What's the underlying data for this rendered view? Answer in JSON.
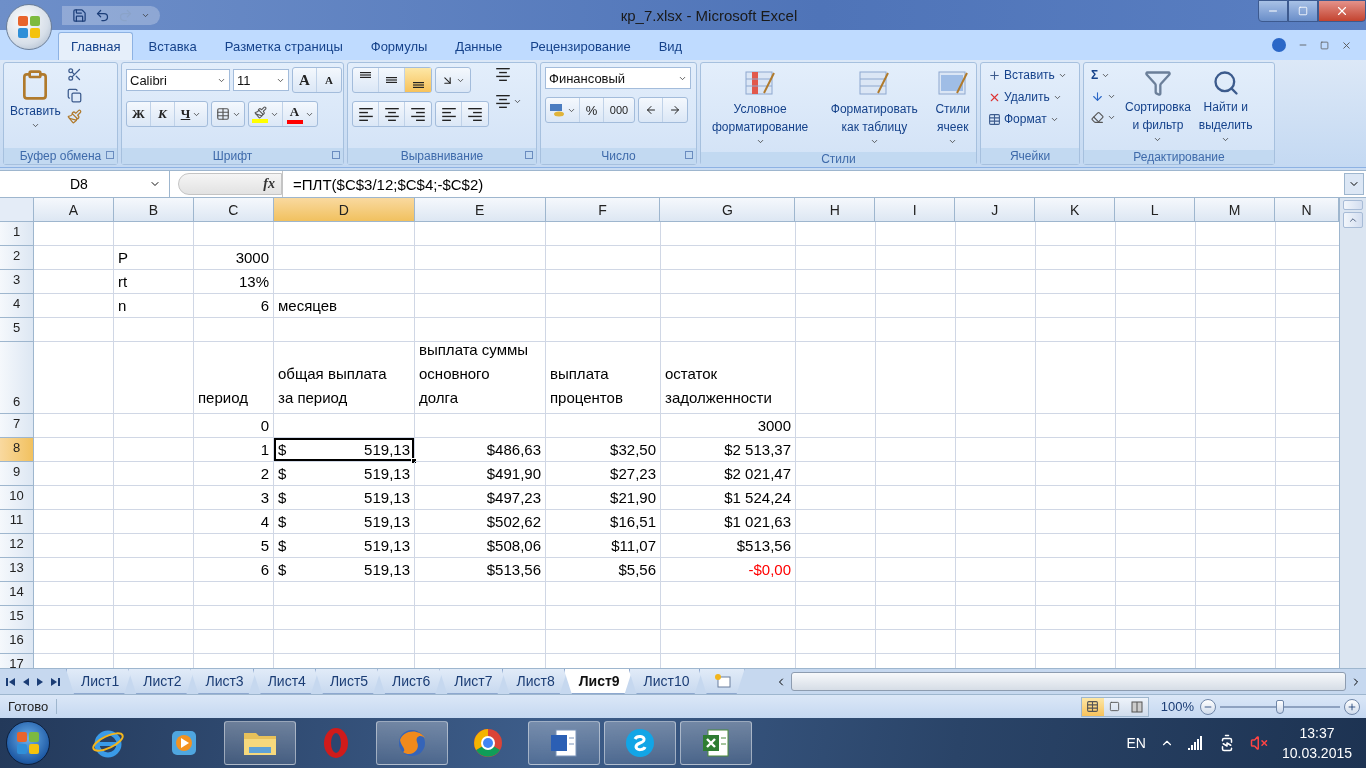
{
  "window": {
    "title": "кр_7.xlsx - Microsoft Excel"
  },
  "ribbon_tabs": [
    {
      "label": "Главная",
      "selected": true
    },
    {
      "label": "Вставка",
      "selected": false
    },
    {
      "label": "Разметка страницы",
      "selected": false
    },
    {
      "label": "Формулы",
      "selected": false
    },
    {
      "label": "Данные",
      "selected": false
    },
    {
      "label": "Рецензирование",
      "selected": false
    },
    {
      "label": "Вид",
      "selected": false
    }
  ],
  "ribbon": {
    "clipboard": {
      "label": "Буфер обмена",
      "paste": "Вставить"
    },
    "font": {
      "label": "Шрифт",
      "font_name": "Calibri",
      "font_size": "11",
      "grow": "A",
      "shrink": "A",
      "bold": "Ж",
      "italic": "К",
      "underline": "Ч",
      "color_letter": "A"
    },
    "alignment": {
      "label": "Выравнивание",
      "vertical": [
        {
          "selected": false
        },
        {
          "selected": false
        },
        {
          "selected": true
        }
      ]
    },
    "number": {
      "label": "Число",
      "format": "Финансовый",
      "percent": "%",
      "thousands": "000"
    },
    "styles": {
      "label": "Стили",
      "buttons": [
        {
          "lines": [
            "Условное",
            "форматирование"
          ]
        },
        {
          "lines": [
            "Форматировать",
            "как таблицу"
          ]
        },
        {
          "lines": [
            "Стили",
            "ячеек"
          ]
        }
      ]
    },
    "cells": {
      "label": "Ячейки",
      "buttons": [
        {
          "kind": "insert",
          "label": "Вставить"
        },
        {
          "kind": "delete",
          "label": "Удалить"
        },
        {
          "kind": "format",
          "label": "Формат"
        }
      ]
    },
    "editing": {
      "label": "Редактирование",
      "sum": "Σ",
      "buttons": [
        {
          "kind": "sort",
          "lines": [
            "Сортировка",
            "и фильтр"
          ]
        },
        {
          "kind": "find",
          "lines": [
            "Найти и",
            "выделить"
          ]
        }
      ]
    }
  },
  "formula_bar": {
    "name_box": "D8",
    "function_label": "fx",
    "formula": "=ПЛТ($C$3/12;$C$4;-$C$2)"
  },
  "columns": [
    {
      "label": "A",
      "selected": false
    },
    {
      "label": "B",
      "selected": false
    },
    {
      "label": "C",
      "selected": false
    },
    {
      "label": "D",
      "selected": true
    },
    {
      "label": "E",
      "selected": false
    },
    {
      "label": "F",
      "selected": false
    },
    {
      "label": "G",
      "selected": false
    },
    {
      "label": "H",
      "selected": false
    },
    {
      "label": "I",
      "selected": false
    },
    {
      "label": "J",
      "selected": false
    },
    {
      "label": "K",
      "selected": false
    },
    {
      "label": "L",
      "selected": false
    },
    {
      "label": "M",
      "selected": false
    },
    {
      "label": "N",
      "selected": false
    }
  ],
  "rows": [
    {
      "number": "1",
      "selected": false
    },
    {
      "number": "2",
      "selected": false,
      "cells": [
        null,
        {
          "kind": "text",
          "text": "P",
          "negative": false,
          "selected": false
        },
        {
          "kind": "number",
          "text": "3000",
          "negative": false,
          "selected": false
        }
      ]
    },
    {
      "number": "3",
      "selected": false,
      "cells": [
        null,
        {
          "kind": "text",
          "text": "rt",
          "negative": false,
          "selected": false
        },
        {
          "kind": "number",
          "text": "13%",
          "negative": false,
          "selected": false
        }
      ]
    },
    {
      "number": "4",
      "selected": false,
      "cells": [
        null,
        {
          "kind": "text",
          "text": "n",
          "negative": false,
          "selected": false
        },
        {
          "kind": "number",
          "text": "6",
          "negative": false,
          "selected": false
        },
        {
          "kind": "text",
          "text": "месяцев",
          "negative": false,
          "selected": false
        }
      ]
    },
    {
      "number": "5",
      "selected": false
    },
    {
      "number": "6",
      "selected": false,
      "cells": [
        null,
        null,
        {
          "kind": "lines",
          "lines": [
            "период"
          ],
          "negative": false,
          "selected": false
        },
        {
          "kind": "lines",
          "lines": [
            "общая выплата",
            "за период"
          ],
          "negative": false,
          "selected": false
        },
        {
          "kind": "lines",
          "lines": [
            "выплата суммы",
            "основного",
            "долга"
          ],
          "negative": false,
          "selected": false
        },
        {
          "kind": "lines",
          "lines": [
            "выплата",
            "процентов"
          ],
          "negative": false,
          "selected": false
        },
        {
          "kind": "lines",
          "lines": [
            "остаток",
            "задолженности"
          ],
          "negative": false,
          "selected": false
        }
      ]
    },
    {
      "number": "7",
      "selected": false,
      "cells": [
        null,
        null,
        {
          "kind": "number",
          "text": "0",
          "negative": false,
          "selected": false
        },
        null,
        null,
        null,
        {
          "kind": "number",
          "text": "3000",
          "negative": false,
          "selected": false
        }
      ]
    },
    {
      "number": "8",
      "selected": true,
      "cells": [
        null,
        null,
        {
          "kind": "number",
          "text": "1",
          "negative": false,
          "selected": false
        },
        {
          "kind": "accounting",
          "symbol": "$",
          "text": "519,13",
          "negative": false,
          "selected": true
        },
        {
          "kind": "number",
          "text": "$486,63",
          "negative": false,
          "selected": false
        },
        {
          "kind": "number",
          "text": "$32,50",
          "negative": false,
          "selected": false
        },
        {
          "kind": "number",
          "text": "$2 513,37",
          "negative": false,
          "selected": false
        }
      ]
    },
    {
      "number": "9",
      "selected": false,
      "cells": [
        null,
        null,
        {
          "kind": "number",
          "text": "2",
          "negative": false,
          "selected": false
        },
        {
          "kind": "accounting",
          "symbol": "$",
          "text": "519,13",
          "negative": false,
          "selected": false
        },
        {
          "kind": "number",
          "text": "$491,90",
          "negative": false,
          "selected": false
        },
        {
          "kind": "number",
          "text": "$27,23",
          "negative": false,
          "selected": false
        },
        {
          "kind": "number",
          "text": "$2 021,47",
          "negative": false,
          "selected": false
        }
      ]
    },
    {
      "number": "10",
      "selected": false,
      "cells": [
        null,
        null,
        {
          "kind": "number",
          "text": "3",
          "negative": false,
          "selected": false
        },
        {
          "kind": "accounting",
          "symbol": "$",
          "text": "519,13",
          "negative": false,
          "selected": false
        },
        {
          "kind": "number",
          "text": "$497,23",
          "negative": false,
          "selected": false
        },
        {
          "kind": "number",
          "text": "$21,90",
          "negative": false,
          "selected": false
        },
        {
          "kind": "number",
          "text": "$1 524,24",
          "negative": false,
          "selected": false
        }
      ]
    },
    {
      "number": "11",
      "selected": false,
      "cells": [
        null,
        null,
        {
          "kind": "number",
          "text": "4",
          "negative": false,
          "selected": false
        },
        {
          "kind": "accounting",
          "symbol": "$",
          "text": "519,13",
          "negative": false,
          "selected": false
        },
        {
          "kind": "number",
          "text": "$502,62",
          "negative": false,
          "selected": false
        },
        {
          "kind": "number",
          "text": "$16,51",
          "negative": false,
          "selected": false
        },
        {
          "kind": "number",
          "text": "$1 021,63",
          "negative": false,
          "selected": false
        }
      ]
    },
    {
      "number": "12",
      "selected": false,
      "cells": [
        null,
        null,
        {
          "kind": "number",
          "text": "5",
          "negative": false,
          "selected": false
        },
        {
          "kind": "accounting",
          "symbol": "$",
          "text": "519,13",
          "negative": false,
          "selected": false
        },
        {
          "kind": "number",
          "text": "$508,06",
          "negative": false,
          "selected": false
        },
        {
          "kind": "number",
          "text": "$11,07",
          "negative": false,
          "selected": false
        },
        {
          "kind": "number",
          "text": "$513,56",
          "negative": false,
          "selected": false
        }
      ]
    },
    {
      "number": "13",
      "selected": false,
      "cells": [
        null,
        null,
        {
          "kind": "number",
          "text": "6",
          "negative": false,
          "selected": false
        },
        {
          "kind": "accounting",
          "symbol": "$",
          "text": "519,13",
          "negative": false,
          "selected": false
        },
        {
          "kind": "number",
          "text": "$513,56",
          "negative": false,
          "selected": false
        },
        {
          "kind": "number",
          "text": "$5,56",
          "negative": false,
          "selected": false
        },
        {
          "kind": "number",
          "text": "-$0,00",
          "negative": true,
          "selected": false
        }
      ]
    },
    {
      "number": "14",
      "selected": false
    },
    {
      "number": "15",
      "selected": false
    },
    {
      "number": "16",
      "selected": false
    },
    {
      "number": "17",
      "selected": false
    }
  ],
  "sheet_tabs": [
    {
      "label": "Лист1",
      "selected": false
    },
    {
      "label": "Лист2",
      "selected": false
    },
    {
      "label": "Лист3",
      "selected": false
    },
    {
      "label": "Лист4",
      "selected": false
    },
    {
      "label": "Лист5",
      "selected": false
    },
    {
      "label": "Лист6",
      "selected": false
    },
    {
      "label": "Лист7",
      "selected": false
    },
    {
      "label": "Лист8",
      "selected": false
    },
    {
      "label": "Лист9",
      "selected": true
    },
    {
      "label": "Лист10",
      "selected": false
    }
  ],
  "status_bar": {
    "status": "Готово",
    "views": [
      {
        "kind": "normal",
        "selected": true
      },
      {
        "kind": "layout",
        "selected": false
      },
      {
        "kind": "pagebreak",
        "selected": false
      }
    ],
    "zoom": "100%",
    "zoom_level": {
      "level": 0.5
    }
  },
  "taskbar": {
    "apps": [
      {
        "kind": "browser",
        "open": false
      },
      {
        "kind": "media",
        "open": false
      },
      {
        "kind": "folder",
        "open": true
      },
      {
        "kind": "ring",
        "open": false
      },
      {
        "kind": "globe",
        "open": true
      },
      {
        "kind": "wheel",
        "open": false
      },
      {
        "kind": "document",
        "open": true
      },
      {
        "kind": "chat",
        "open": true
      },
      {
        "kind": "sheet",
        "open": true
      }
    ],
    "language": "EN",
    "time": "13:37",
    "date": "10.03.2015"
  }
}
